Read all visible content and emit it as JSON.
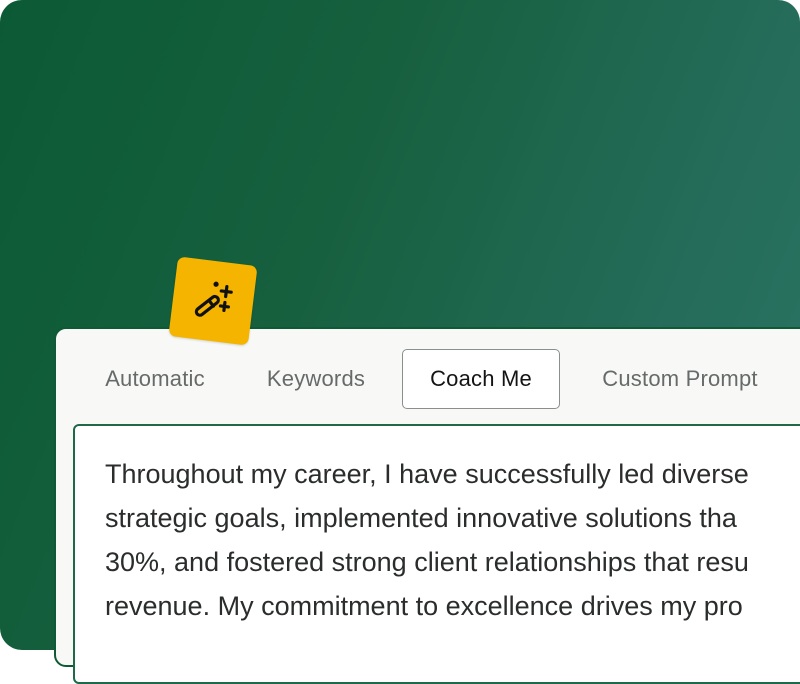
{
  "tabs": [
    {
      "label": "Automatic",
      "active": false
    },
    {
      "label": "Keywords",
      "active": false
    },
    {
      "label": "Coach Me",
      "active": true
    },
    {
      "label": "Custom Prompt",
      "active": false
    }
  ],
  "editor": {
    "lines": [
      "Throughout my career, I have successfully led diverse",
      "strategic goals, implemented innovative solutions tha",
      "30%, and fostered strong client relationships that resu",
      "revenue. My commitment to excellence drives my pro"
    ]
  },
  "icons": {
    "badge": "magic-wand-icon"
  },
  "colors": {
    "background_start": "#0b5a35",
    "background_end": "#2b7564",
    "badge": "#f4b400",
    "panel_border": "#0e5a36"
  }
}
